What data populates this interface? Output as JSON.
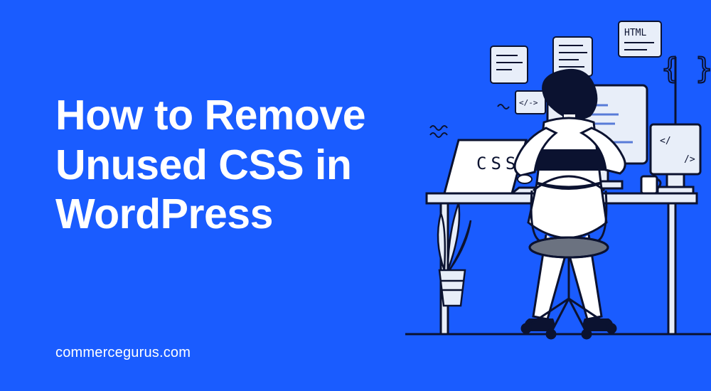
{
  "headline": "How to Remove\nUnused CSS in\nWordPress",
  "site": "commercegurus.com",
  "illustration": {
    "laptop_label": "CSS",
    "note_html": "HTML"
  }
}
